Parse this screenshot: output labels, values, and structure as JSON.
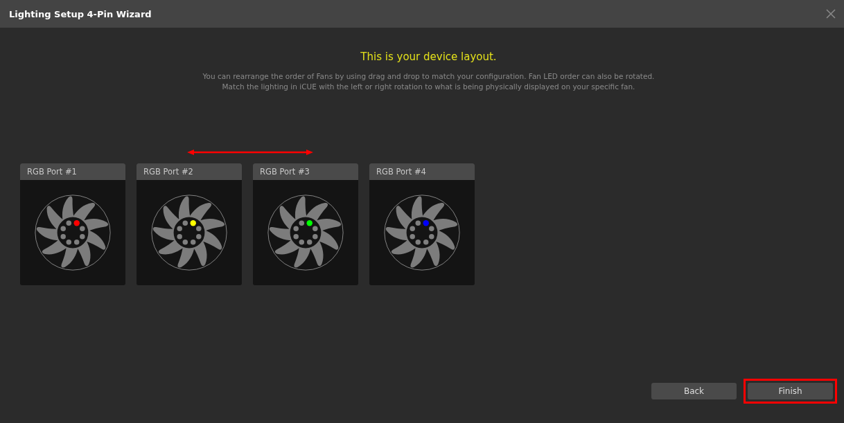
{
  "window": {
    "title": "Lighting Setup 4-Pin Wizard"
  },
  "heading": "This is your device layout.",
  "description": [
    "You can rearrange the order of Fans by using drag and drop to match your configuration. Fan LED order can also be rotated.",
    "Match the lighting in iCUE with the left or right rotation to what is being physically displayed on your specific fan."
  ],
  "ports": [
    {
      "label": "RGB Port #1",
      "color": "#ff0000"
    },
    {
      "label": "RGB Port #2",
      "color": "#ffff00"
    },
    {
      "label": "RGB Port #3",
      "color": "#00ff00"
    },
    {
      "label": "RGB Port #4",
      "color": "#0000ff"
    }
  ],
  "buttons": [
    {
      "label": "Back",
      "highlighted": false
    },
    {
      "label": "Finish",
      "highlighted": true
    }
  ]
}
